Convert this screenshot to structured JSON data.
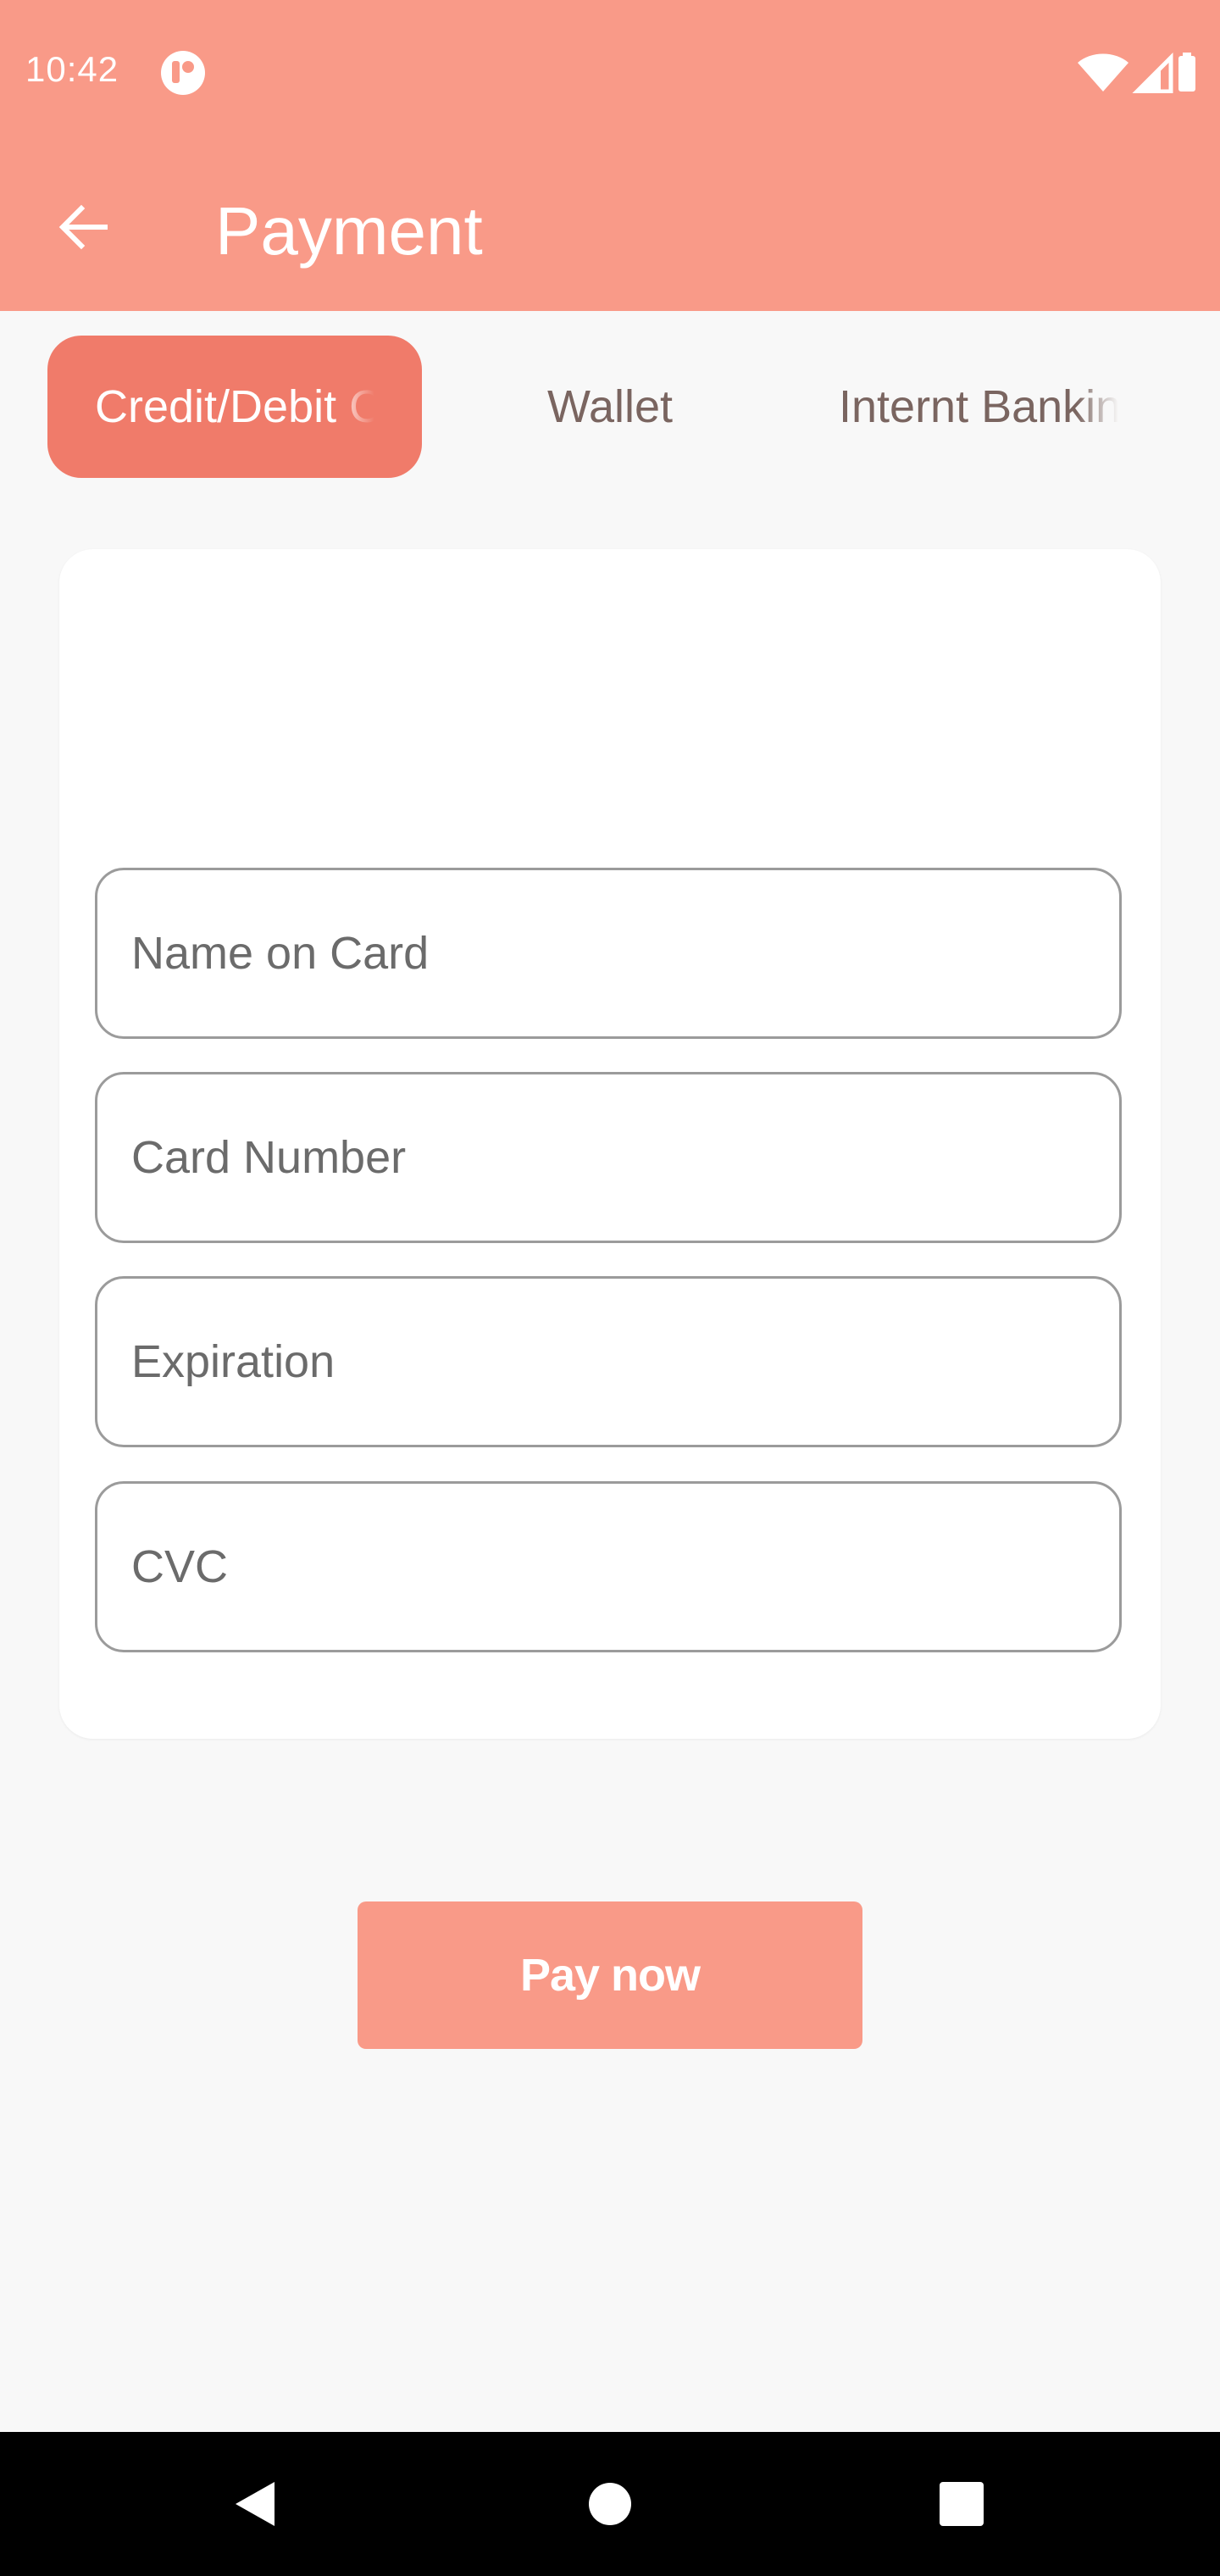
{
  "status_bar": {
    "time": "10:42",
    "icons": [
      "app-notification-icon",
      "wifi-icon",
      "signal-icon",
      "battery-icon"
    ]
  },
  "app_bar": {
    "title": "Payment",
    "back_icon": "arrow-back-icon"
  },
  "tabs": [
    {
      "label": "Credit/Debit Card",
      "active": true
    },
    {
      "label": "Wallet",
      "active": false
    },
    {
      "label": "Internt Banking",
      "active": false
    }
  ],
  "form": {
    "fields": [
      {
        "placeholder": "Name on Card",
        "value": ""
      },
      {
        "placeholder": "Card Number",
        "value": ""
      },
      {
        "placeholder": "Expiration",
        "value": ""
      },
      {
        "placeholder": "CVC",
        "value": ""
      }
    ]
  },
  "pay_button": {
    "label": "Pay now"
  },
  "nav_bar": {
    "icons": [
      "back-triangle-icon",
      "home-circle-icon",
      "recents-square-icon"
    ]
  },
  "colors": {
    "header": "#f99a88",
    "active_tab": "#f07b6a",
    "pay_button": "#f99a88",
    "background": "#f8f8f8",
    "inactive_tab_text": "#7a6560"
  }
}
